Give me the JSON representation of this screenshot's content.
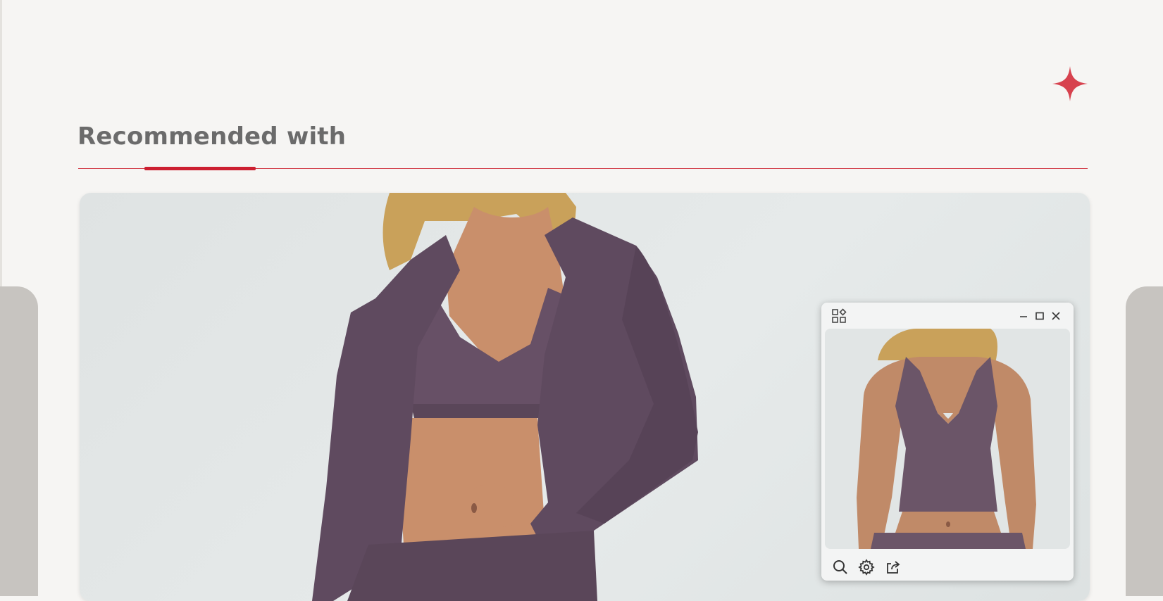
{
  "section": {
    "title": "Recommended with"
  },
  "colors": {
    "accent": "#cc1f30",
    "sparkle": "#d7424e",
    "heading": "#6b6b6b",
    "garment": "#5f4a5f"
  },
  "icons": {
    "sparkle": "four-point-star-icon",
    "popup_menu": "apps-grid-icon",
    "minimize": "minimize-icon",
    "maximize": "maximize-icon",
    "close": "close-icon",
    "zoom": "search-icon",
    "settings": "gear-icon",
    "share": "share-icon"
  }
}
